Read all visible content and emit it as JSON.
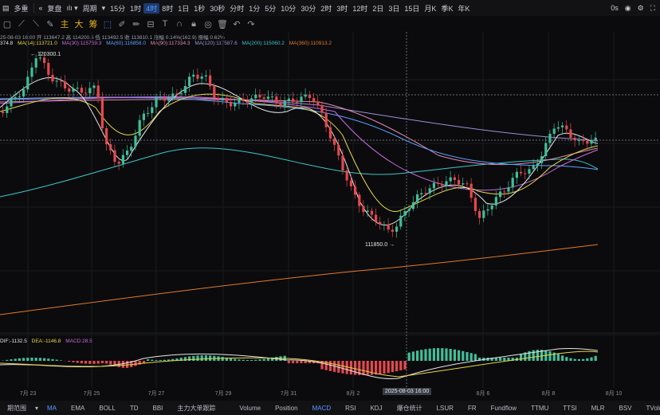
{
  "toolbar": {
    "symbol": "多重",
    "replay": "复盘",
    "period": "周期",
    "timeframes": [
      "15分",
      "1时",
      "4时",
      "8时",
      "1日",
      "1秒",
      "30秒",
      "分时",
      "1分",
      "5分",
      "10分",
      "30分",
      "2时",
      "3时",
      "12时",
      "2日",
      "3日",
      "15日",
      "月K",
      "季K",
      "年K"
    ],
    "active_timeframe": "4时",
    "right_label": "0s"
  },
  "drawbar": {
    "zh1": "主",
    "zh2": "大",
    "zh3": "筹"
  },
  "ohlc": {
    "date": "25-08-03 16:00",
    "open": "开 113647.2",
    "high": "高 114200.6",
    "low": "低 113492.5",
    "close": "收 113810.1",
    "change": "涨幅 0.14%(162.9)",
    "amplitude": "振幅 0.62%"
  },
  "ma": {
    "ma_first": "374.8",
    "ma14": "MA(14):113721.0",
    "ma30": "MA(30):115759.3",
    "ma60": "MA(60):116858.0",
    "ma90": "MA(90):117334.3",
    "ma120": "MA(120):117587.6",
    "ma200": "MA(200):115060.2",
    "ma360": "MA(360):110913.2"
  },
  "colors": {
    "up": "#3fbf9a",
    "down": "#e5484d",
    "ma7": "#e6e6e6",
    "ma14": "#e6d64a",
    "ma30": "#c86be0",
    "ma60": "#5aa0ff",
    "ma90": "#e08ab0",
    "ma120": "#9b8fd6",
    "ma200": "#3ec6c6",
    "ma360": "#e07a2a",
    "dif": "#e6e6e6",
    "dea": "#e6d64a"
  },
  "annotations": {
    "high_label": "120300.1",
    "low_label": "111850.0"
  },
  "macd": {
    "dif": "DIF:-1132.5",
    "dea": "DEA:-1146.8",
    "macd": "MACD:28.5"
  },
  "dates": [
    "7月 23",
    "7月 25",
    "7月 27",
    "7月 29",
    "7月 31",
    "8月 2",
    "8月 6",
    "8月 8",
    "8月 10"
  ],
  "crosshair_date": "2025-08-03 16:00",
  "indicator_tabs": [
    "期范围",
    "MA",
    "EMA",
    "BOLL",
    "TD",
    "BBI",
    "主力大单跟踪",
    "Volume",
    "Position",
    "MACD",
    "RSI",
    "KDJ",
    "爆仓统计",
    "LSUR",
    "FR",
    "Fundflow",
    "TTMU",
    "TTSI",
    "MLR",
    "BSV",
    "TVolume"
  ],
  "active_indicator_main": "MA",
  "active_indicator_sub": "MACD"
}
